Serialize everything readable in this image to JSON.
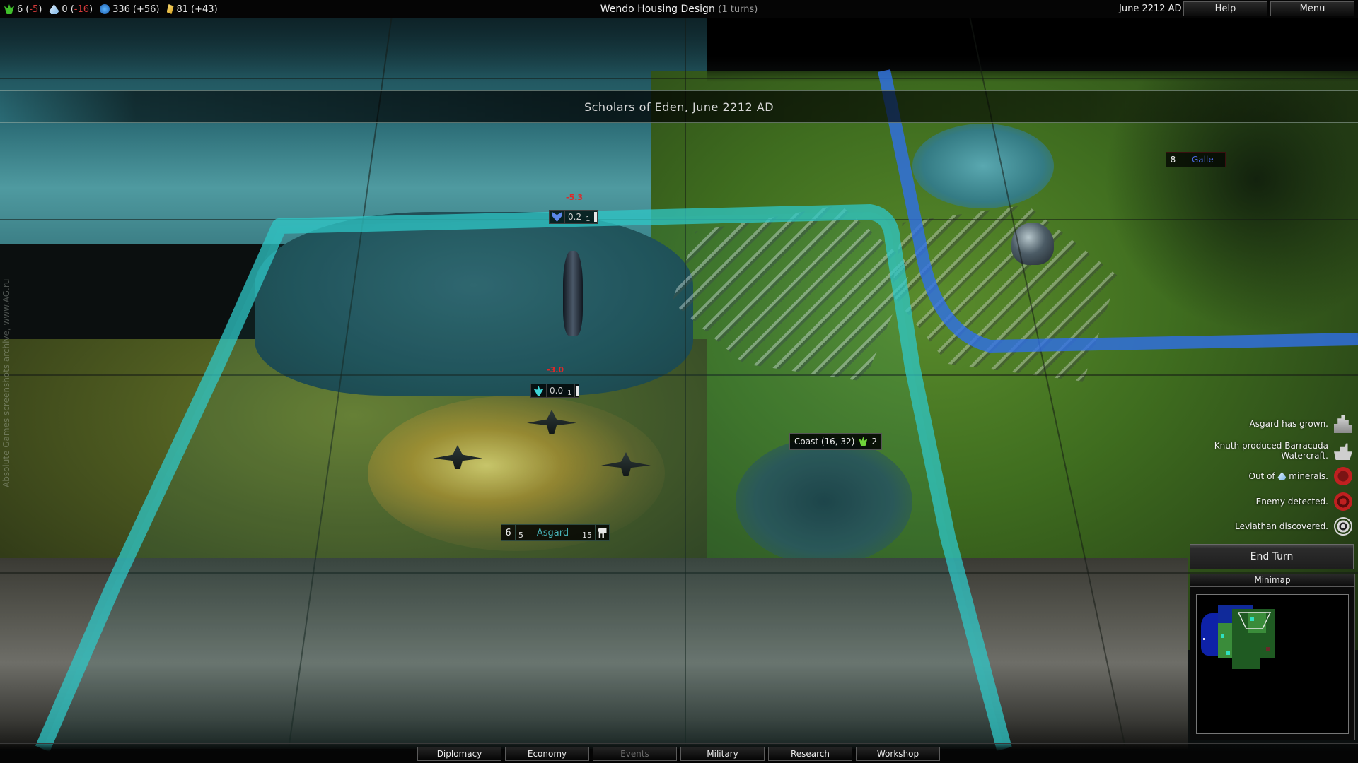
{
  "topbar": {
    "resources": [
      {
        "icon": "food-icon",
        "value": "6",
        "delta": "-5",
        "delta_negative": true
      },
      {
        "icon": "minerals-icon",
        "value": "0",
        "delta": "-16",
        "delta_negative": true
      },
      {
        "icon": "research-icon",
        "value": "336",
        "delta": "+56",
        "delta_negative": false
      },
      {
        "icon": "credits-icon",
        "value": "81",
        "delta": "+43",
        "delta_negative": false
      }
    ],
    "project_name": "Wendo Housing Design",
    "project_turns": "(1 turns)",
    "date": "June 2212 AD",
    "help_label": "Help",
    "menu_label": "Menu"
  },
  "banner": {
    "text": "Scholars of Eden, June 2212 AD"
  },
  "units": [
    {
      "name": "ship-unit",
      "emblem": "chevron-shield-icon",
      "damage": "-5.3",
      "value": "0.2",
      "count": "1"
    },
    {
      "name": "aircraft-unit",
      "emblem": "wing-emblem-icon",
      "damage": "-3.0",
      "value": "0.0",
      "count": "1"
    }
  ],
  "player_city": {
    "name": "Asgard",
    "population": "6",
    "left_value": "5",
    "right_value": "15",
    "production_icon": "mech-icon"
  },
  "enemy_city": {
    "name": "Galle",
    "population": "8"
  },
  "tile_tooltip": {
    "terrain": "Coast (16, 32)",
    "food_icon": "food-icon",
    "food": "2"
  },
  "events": [
    {
      "text": "Asgard has grown.",
      "icon": "city-growth-icon"
    },
    {
      "text": "Knuth produced Barracuda Watercraft.",
      "icon": "ship-icon"
    },
    {
      "text_before": "Out of",
      "inline_icon": "minerals-icon",
      "text_after": "minerals.",
      "icon": "no-minerals-icon"
    },
    {
      "text": "Enemy detected.",
      "icon": "enemy-alert-icon"
    },
    {
      "text": "Leviathan discovered.",
      "icon": "eye-icon"
    }
  ],
  "end_turn_label": "End Turn",
  "minimap": {
    "title": "Minimap"
  },
  "bottom_tabs": [
    {
      "label": "Diplomacy",
      "enabled": true
    },
    {
      "label": "Economy",
      "enabled": true
    },
    {
      "label": "Events",
      "enabled": false
    },
    {
      "label": "Military",
      "enabled": true
    },
    {
      "label": "Research",
      "enabled": true
    },
    {
      "label": "Workshop",
      "enabled": true
    }
  ],
  "watermark": "Absolute Games screenshots archive, www.AG.ru",
  "colors": {
    "territory_player": "#2fc7c7",
    "territory_enemy": "#2f6fe8",
    "negative": "#d43a3a",
    "player_city_name": "#47b3b8",
    "enemy_city_name": "#4a68e0"
  }
}
